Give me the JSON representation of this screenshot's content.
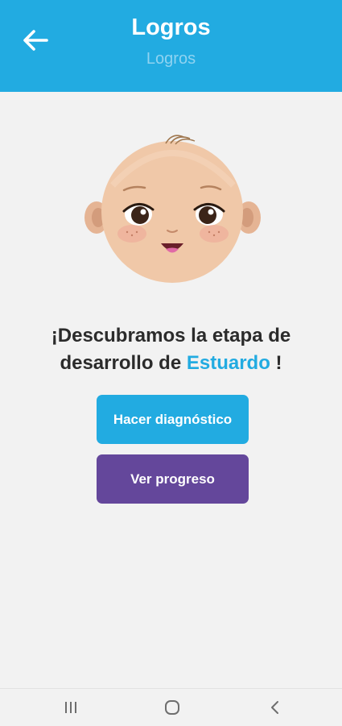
{
  "header": {
    "title": "Logros",
    "subtitle": "Logros",
    "back_icon": "arrow-left-icon",
    "background_color": "#22abe1"
  },
  "main": {
    "illustration_icon": "baby-face-icon",
    "headline_part1": "¡Descubramos la etapa de desarrollo de ",
    "child_name": "Estuardo",
    "headline_part2": " !",
    "name_color": "#22abe1",
    "buttons": {
      "diagnostic_label": "Hacer diagnóstico",
      "diagnostic_color": "#22abe1",
      "progress_label": "Ver progreso",
      "progress_color": "#64479b"
    }
  },
  "system_nav": {
    "recents_icon": "recents-icon",
    "home_icon": "home-icon",
    "back_icon": "back-chevron-icon"
  }
}
